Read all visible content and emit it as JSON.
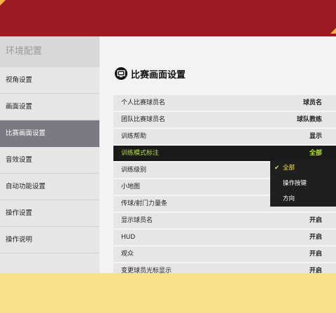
{
  "sidebar": {
    "header": "环境配置",
    "items": [
      {
        "label": "视角设置",
        "active": false
      },
      {
        "label": "画面设置",
        "active": false
      },
      {
        "label": "比赛画面设置",
        "active": true
      },
      {
        "label": "音效设置",
        "active": false
      },
      {
        "label": "自动功能设置",
        "active": false
      },
      {
        "label": "操作设置",
        "active": false
      },
      {
        "label": "操作说明",
        "active": false
      }
    ]
  },
  "content": {
    "title": "比赛画面设置",
    "icon": "screen-settings-icon",
    "rows": [
      {
        "label": "个人比赛球员名",
        "value": "球员名"
      },
      {
        "label": "团队比赛球员名",
        "value": "球队教练"
      },
      {
        "label": "训练帮助",
        "value": "显示"
      },
      {
        "label": "训练模式标注",
        "value": "全部",
        "selected": true
      },
      {
        "label": "训练级别",
        "value": ""
      },
      {
        "label": "小地图",
        "value": ""
      },
      {
        "label": "传球/射门力量条",
        "value": ""
      },
      {
        "label": "显示球员名",
        "value": "开启"
      },
      {
        "label": "HUD",
        "value": "开启"
      },
      {
        "label": "观众",
        "value": "开启"
      },
      {
        "label": "变更球员光标显示",
        "value": "开启"
      }
    ]
  },
  "dropdown": {
    "options": [
      {
        "label": "全部",
        "checked": true
      },
      {
        "label": "操作按键",
        "checked": false
      },
      {
        "label": "方向",
        "checked": false
      }
    ],
    "check_glyph": "✔"
  },
  "colors": {
    "topbar": "#9b1b22",
    "accent_corner": "#f2b340",
    "selected_text": "#b6e23a",
    "checked_text": "#f4e64a",
    "footer": "#fbe08b"
  }
}
